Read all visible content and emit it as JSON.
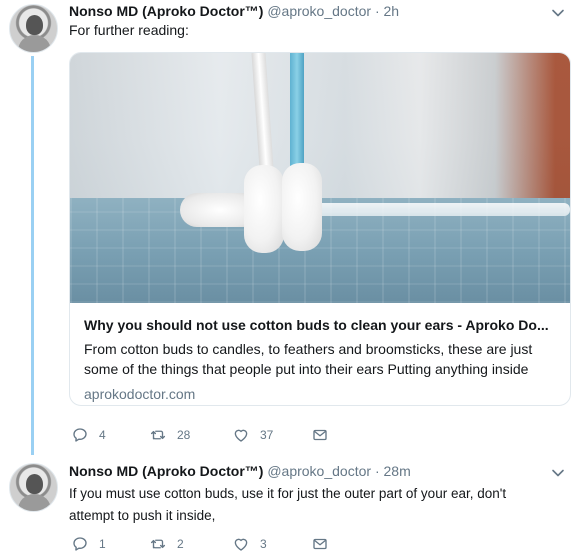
{
  "thread": {
    "tweets": [
      {
        "author_name": "Nonso MD (Aproko Doctor™)",
        "handle": "@aproko_doctor",
        "separator": "·",
        "time": "2h",
        "text": "For further reading:",
        "card": {
          "title": "Why you should not use cotton buds to clean your ears - Aproko Do...",
          "description": "From cotton buds to candles, to feathers and broomsticks, these are just some of the things that people put into their ears   Putting anything inside",
          "domain": "aprokodoctor.com"
        },
        "actions": {
          "replies": "4",
          "retweets": "28",
          "likes": "37"
        }
      },
      {
        "author_name": "Nonso MD (Aproko Doctor™)",
        "handle": "@aproko_doctor",
        "separator": "·",
        "time": "28m",
        "text": "If you must use cotton buds, use it for just the outer part of your ear, don't attempt to push it inside,",
        "actions": {
          "replies": "1",
          "retweets": "2",
          "likes": "3"
        }
      }
    ]
  },
  "icons": {
    "caret": "chevron-down-icon",
    "reply": "reply-icon",
    "retweet": "retweet-icon",
    "like": "heart-icon",
    "dm": "envelope-icon"
  },
  "colors": {
    "thread_line": "#9ad0f3",
    "secondary_text": "#657786",
    "primary_text": "#14171a",
    "border": "#e1e8ed"
  }
}
